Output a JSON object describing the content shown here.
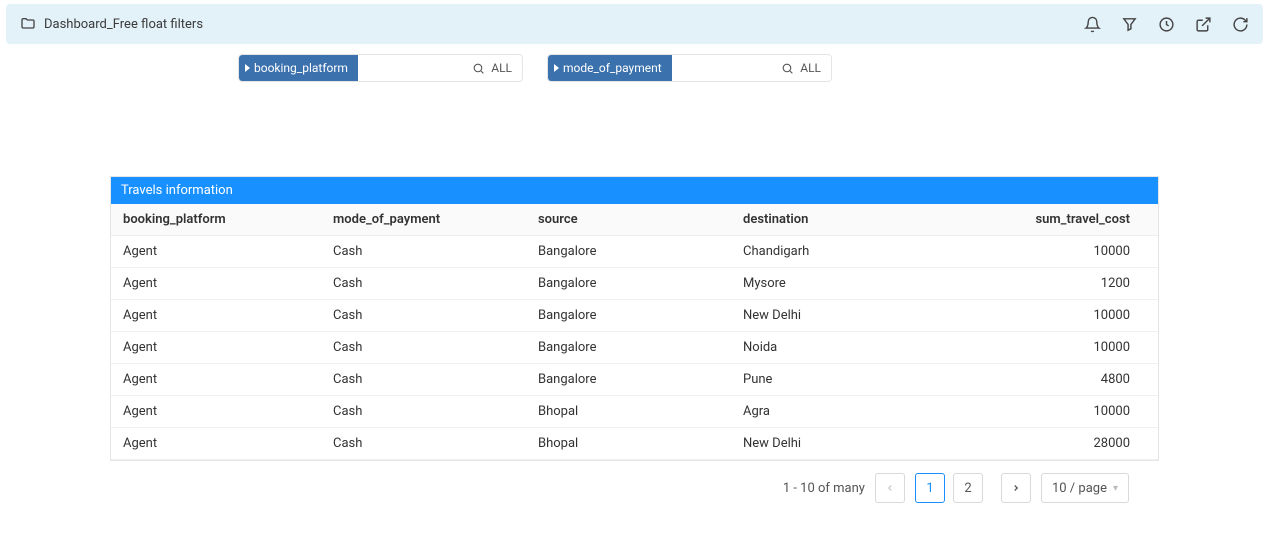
{
  "header": {
    "title": "Dashboard_Free float filters"
  },
  "filters": [
    {
      "name": "booking_platform",
      "value": "ALL"
    },
    {
      "name": "mode_of_payment",
      "value": "ALL"
    }
  ],
  "table": {
    "title": "Travels information",
    "columns": [
      "booking_platform",
      "mode_of_payment",
      "source",
      "destination",
      "sum_travel_cost"
    ],
    "rows": [
      {
        "booking_platform": "Agent",
        "mode_of_payment": "Cash",
        "source": "Bangalore",
        "destination": "Chandigarh",
        "sum_travel_cost": "10000"
      },
      {
        "booking_platform": "Agent",
        "mode_of_payment": "Cash",
        "source": "Bangalore",
        "destination": "Mysore",
        "sum_travel_cost": "1200"
      },
      {
        "booking_platform": "Agent",
        "mode_of_payment": "Cash",
        "source": "Bangalore",
        "destination": "New Delhi",
        "sum_travel_cost": "10000"
      },
      {
        "booking_platform": "Agent",
        "mode_of_payment": "Cash",
        "source": "Bangalore",
        "destination": "Noida",
        "sum_travel_cost": "10000"
      },
      {
        "booking_platform": "Agent",
        "mode_of_payment": "Cash",
        "source": "Bangalore",
        "destination": "Pune",
        "sum_travel_cost": "4800"
      },
      {
        "booking_platform": "Agent",
        "mode_of_payment": "Cash",
        "source": "Bhopal",
        "destination": "Agra",
        "sum_travel_cost": "10000"
      },
      {
        "booking_platform": "Agent",
        "mode_of_payment": "Cash",
        "source": "Bhopal",
        "destination": "New Delhi",
        "sum_travel_cost": "28000"
      }
    ]
  },
  "pagination": {
    "summary": "1 - 10 of many",
    "pages": [
      "1",
      "2"
    ],
    "active_page": "1",
    "page_size_label": "10 / page"
  }
}
